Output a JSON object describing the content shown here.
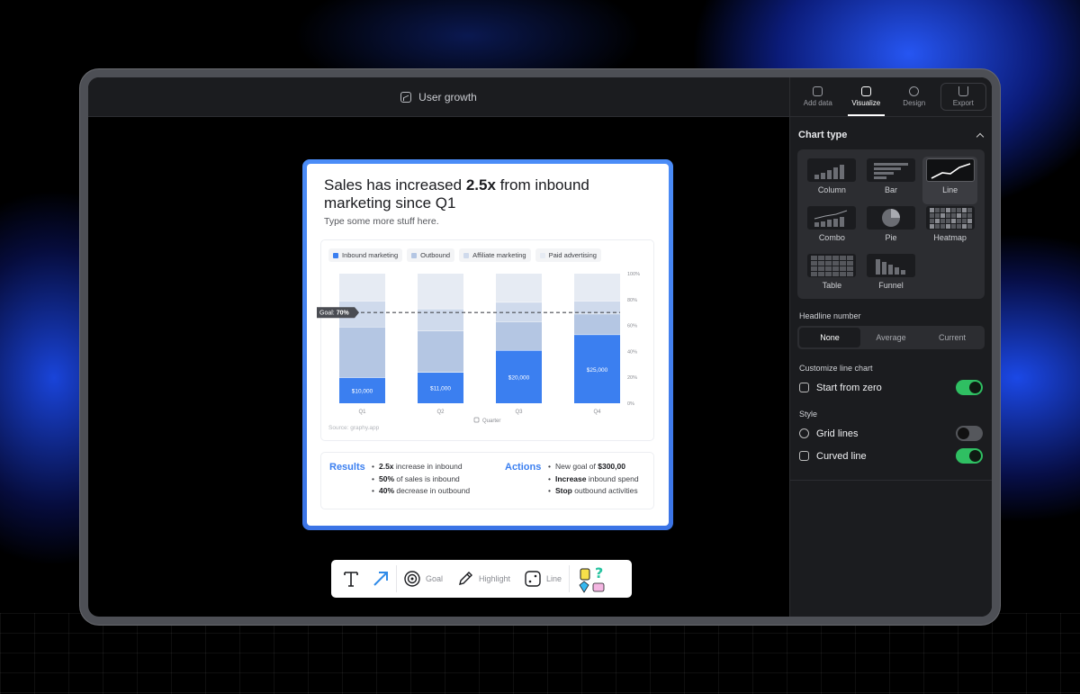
{
  "window": {
    "title": "User growth"
  },
  "tabs": [
    {
      "label": "Add data",
      "icon": "table-icon"
    },
    {
      "label": "Visualize",
      "icon": "chart-icon",
      "active": true
    },
    {
      "label": "Design",
      "icon": "palette-icon"
    },
    {
      "label": "Export",
      "icon": "download-icon"
    }
  ],
  "panel": {
    "chart_type_title": "Chart type",
    "chart_types": [
      "Column",
      "Bar",
      "Line",
      "Combo",
      "Pie",
      "Heatmap",
      "Table",
      "Funnel"
    ],
    "selected_type": "Line",
    "headline_label": "Headline number",
    "headline_options": [
      "None",
      "Average",
      "Current"
    ],
    "headline_selected": "None",
    "customize_label": "Customize line chart",
    "start_from_zero": {
      "label": "Start from zero",
      "on": true
    },
    "style_label": "Style",
    "grid_lines": {
      "label": "Grid lines",
      "on": false
    },
    "curved_line": {
      "label": "Curved line",
      "on": true
    }
  },
  "card": {
    "title_pre": "Sales has increased ",
    "title_bold": "2.5x",
    "title_post": " from inbound marketing since Q1",
    "subtitle": "Type some more stuff here.",
    "source": "Source: graphy.app",
    "results": {
      "heading": "Results",
      "items": [
        {
          "bold": "2.5x",
          "text": " increase in inbound"
        },
        {
          "bold": "50%",
          "text": " of sales is inbound"
        },
        {
          "bold": "40%",
          "text": " decrease in outbound"
        }
      ]
    },
    "actions": {
      "heading": "Actions",
      "items": [
        {
          "pre": "New goal of ",
          "bold": "$300,00",
          "text": ""
        },
        {
          "pre": "",
          "bold": "Increase",
          "text": " inbound spend"
        },
        {
          "pre": "",
          "bold": "Stop",
          "text": " outbound activities"
        }
      ]
    }
  },
  "chart_data": {
    "type": "bar",
    "stacked": "percent",
    "categories": [
      "Q1",
      "Q2",
      "Q3",
      "Q4"
    ],
    "series": [
      {
        "name": "Inbound marketing",
        "color": "#3b7ff0",
        "values": [
          20,
          24,
          41,
          53
        ]
      },
      {
        "name": "Outbound",
        "color": "#b4c6e3",
        "values": [
          39,
          32,
          22,
          16
        ]
      },
      {
        "name": "Affiliate marketing",
        "color": "#cfdaec",
        "values": [
          20,
          17,
          15,
          10
        ]
      },
      {
        "name": "Paid advertising",
        "color": "#e6ebf3",
        "values": [
          21,
          27,
          22,
          21
        ]
      }
    ],
    "bar_labels": [
      "$10,000",
      "$11,000",
      "$20,000",
      "$25,000"
    ],
    "xlabel": "Quarter",
    "y_ticks": [
      "0%",
      "20%",
      "40%",
      "60%",
      "80%",
      "100%"
    ],
    "ylim": [
      0,
      100
    ],
    "goal": {
      "label_prefix": "Goal: ",
      "label_value": "70%",
      "value": 70
    }
  },
  "toolbar": {
    "items": [
      {
        "label": "",
        "icon": "text-icon"
      },
      {
        "label": "",
        "icon": "arrow-icon"
      },
      {
        "label": "Goal",
        "icon": "target-icon"
      },
      {
        "label": "Highlight",
        "icon": "pen-icon"
      },
      {
        "label": "Line",
        "icon": "line-icon"
      },
      {
        "label": "",
        "icon": "sticker-icon"
      }
    ]
  }
}
